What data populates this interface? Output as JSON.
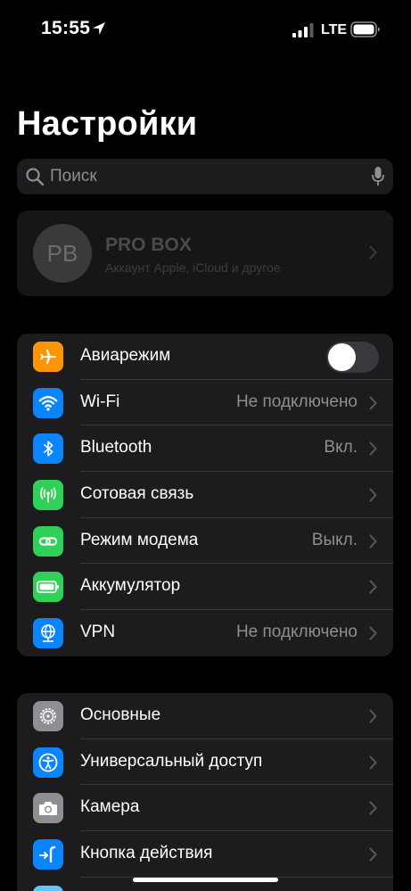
{
  "status_bar": {
    "time": "15:55",
    "network": "LTE"
  },
  "title": "Настройки",
  "search": {
    "placeholder": "Поиск"
  },
  "profile": {
    "initials": "PB",
    "name": "PRO BOX",
    "subtitle": "Аккаунт Apple, iCloud и другое"
  },
  "group1": {
    "items": [
      {
        "label": "Авиарежим",
        "icon": "airplane-icon",
        "color": "#ff9500",
        "toggle": false
      },
      {
        "label": "Wi-Fi",
        "value": "Не подключено",
        "icon": "wifi-icon",
        "color": "#0a84ff"
      },
      {
        "label": "Bluetooth",
        "value": "Вкл.",
        "icon": "bluetooth-icon",
        "color": "#0a84ff"
      },
      {
        "label": "Сотовая связь",
        "value": "",
        "icon": "antenna-icon",
        "color": "#30d158"
      },
      {
        "label": "Режим модема",
        "value": "Выкл.",
        "icon": "hotspot-icon",
        "color": "#30d158"
      },
      {
        "label": "Аккумулятор",
        "value": "",
        "icon": "battery-icon",
        "color": "#30d158"
      },
      {
        "label": "VPN",
        "value": "Не подключено",
        "icon": "vpn-globe-icon",
        "color": "#0a84ff"
      }
    ]
  },
  "group2": {
    "items": [
      {
        "label": "Основные",
        "icon": "gear-icon",
        "color": "#8e8e93"
      },
      {
        "label": "Универсальный доступ",
        "icon": "accessibility-icon",
        "color": "#0a84ff"
      },
      {
        "label": "Камера",
        "icon": "camera-icon",
        "color": "#8e8e93"
      },
      {
        "label": "Кнопка действия",
        "icon": "action-button-icon",
        "color": "#0a84ff"
      }
    ]
  }
}
